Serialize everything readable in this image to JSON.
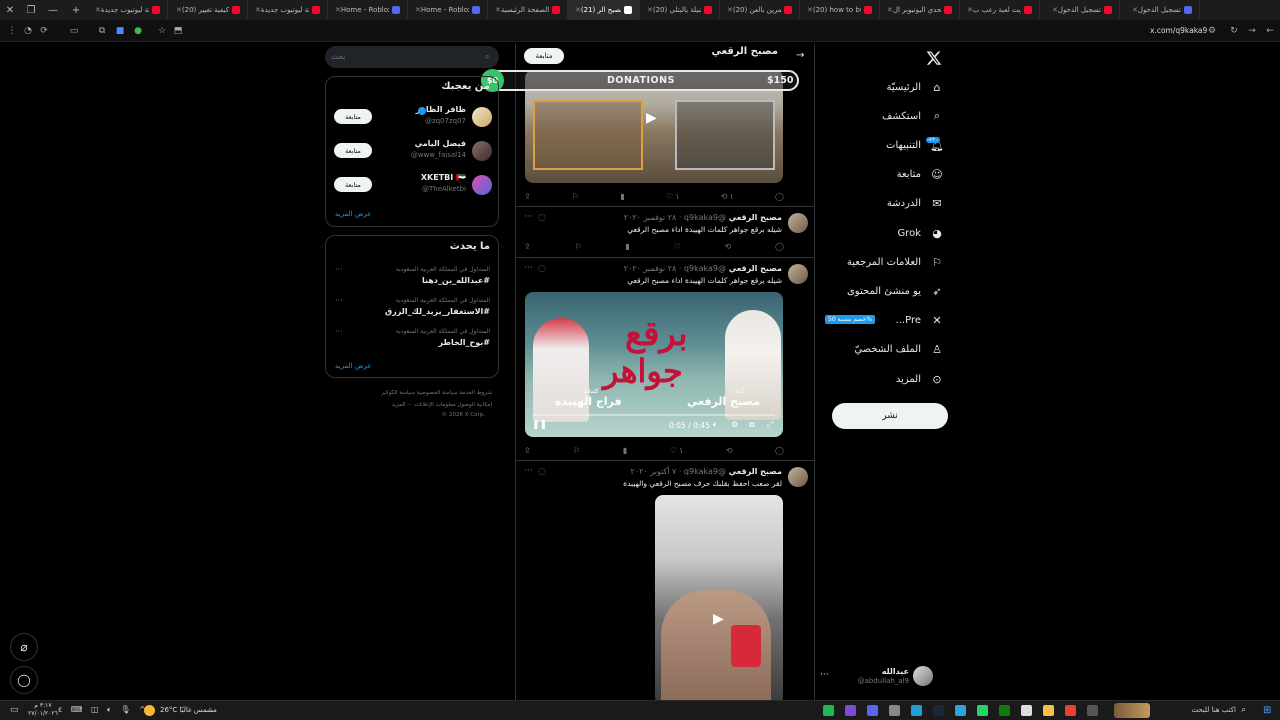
{
  "browser": {
    "tabs": [
      {
        "label": "علامة ليوتيوب جديدة",
        "color": "#ff0033"
      },
      {
        "label": "(20) كيفية تغيير",
        "color": "#ff0033"
      },
      {
        "label": "علامة ليوتيوب جديدة",
        "color": "#ff0033"
      },
      {
        "label": "Home - Roblox",
        "color": "#5865f2"
      },
      {
        "label": "Home - Roblox",
        "color": "#5865f2"
      },
      {
        "label": "الصفحة الرئيسية",
        "color": "#ff0033"
      },
      {
        "label": "(21) مصبح الر",
        "color": "#ffffff"
      },
      {
        "label": "(20) شيلة يالبتلي",
        "color": "#ff0033"
      },
      {
        "label": "(20) التمرين بالعن",
        "color": "#ff0033"
      },
      {
        "label": "(20) how to buy",
        "color": "#ff0033"
      },
      {
        "label": "تحدي اليوتيوبر ال",
        "color": "#ff0033"
      },
      {
        "label": "جربت لعبة رعب ب",
        "color": "#ff0033"
      },
      {
        "label": "تسجيل الدخول",
        "color": "#ff0033"
      },
      {
        "label": "تسجيل الدخول",
        "color": "#5865f2"
      }
    ],
    "url": "x.com/q9kaka9"
  },
  "nav": {
    "items": [
      {
        "label": "الرئيسيّة",
        "icon": "home-icon"
      },
      {
        "label": "استكشف",
        "icon": "search-icon"
      },
      {
        "label": "التنبيهات",
        "icon": "bell-icon"
      },
      {
        "label": "متابعة",
        "icon": "follow-icon"
      },
      {
        "label": "الدردشة",
        "icon": "mail-icon"
      },
      {
        "label": "Grok",
        "icon": "grok-icon"
      },
      {
        "label": "العلامات المرجعية",
        "icon": "bookmark-icon"
      },
      {
        "label": "يو منشئ المحتوى",
        "icon": "rocket-icon"
      },
      {
        "label": "Pre...",
        "icon": "x-premium-icon"
      },
      {
        "label": "الملف الشخصيّ",
        "icon": "profile-icon"
      },
      {
        "label": "المزيد",
        "icon": "more-icon"
      }
    ],
    "notif_badge": "+٢٠",
    "premium_badge": "خصم بنسبة 50%",
    "post_button": "نشر",
    "account": {
      "name": "عبدالله",
      "handle": "@abdullah_al9"
    }
  },
  "feed": {
    "header_name": "مصبح الرقعي",
    "header_follow": "متابعة",
    "tweet0_stats": {
      "likes": "١",
      "reposts": "١",
      "comments": ""
    },
    "tweets": [
      {
        "name": "مصبح الرقعي",
        "meta": "@q9kaka9 · ٢٨ نوفمبر ٢٠٢٠",
        "text": "شيله برقع جواهر كلمات الهيبدة اداء مصبح الرقعي"
      },
      {
        "name": "مصبح الرقعي",
        "meta": "@q9kaka9 · ٢٨ نوفمبر ٢٠٢٠",
        "text": "شيله برقع جواهر كلمات الهيبدة اداء مصبح الرقعي"
      },
      {
        "name": "مصبح الرقعي",
        "meta": "@q9kaka9 · ٧ أكتوبر ٢٠٢٠",
        "text": "لقر صعب احفظ بقلبك حرف  مصبح الرقعي والهيبدة"
      }
    ],
    "video": {
      "title_line1": "برقع",
      "title_line2": "جواهر",
      "performer": "مصبح الرقعي",
      "performer_role": "أداء",
      "writer": "فراج الهيبده",
      "writer_role": "كلمات",
      "time": "0:05 / 0:45",
      "likes": "١"
    }
  },
  "sidebar": {
    "search_placeholder": "بحث",
    "who_to_follow_title": "من يعجبك",
    "follow_label": "متابعة",
    "users": [
      {
        "name": "ظافر الظافر",
        "handle": "@zq07zq07",
        "verified": true
      },
      {
        "name": "فيصل اليامي",
        "handle": "@www_faisal14",
        "verified": false
      },
      {
        "name": "XKETBI 🇦🇪",
        "handle": "@TheAlketbi",
        "verified": false
      }
    ],
    "show_more": "عرض المزيد",
    "trending_title": "ما يحدث",
    "trends": [
      {
        "category": "المتداول في المملكة العربية السعودية",
        "tag": "#عبدالله_بن_دهنا"
      },
      {
        "category": "المتداول في المملكة العربية السعودية",
        "tag": "#الاستغفار_يزيد_لك_الرزق"
      },
      {
        "category": "المتداول في المملكة العربية السعودية",
        "tag": "#بوح_الخاطر"
      }
    ],
    "footer_line1": "شروط الخدمة  سياسة الخصوصية  سياسة الكوكيز",
    "footer_line2": "إمكانية الوصول  معلومات الإعلانات  ··· المزيد",
    "footer_line3": "© 2026 X Corp."
  },
  "donations": {
    "left": "$0",
    "center": "DONATIONS",
    "right": "$150"
  },
  "taskbar": {
    "search_placeholder": "اكتب هنا للبحث",
    "weather": "26°C  مشمس غالبًا",
    "time": "٣:١٧ م",
    "date": "٢٧/٠١/٢٠٢٦"
  }
}
